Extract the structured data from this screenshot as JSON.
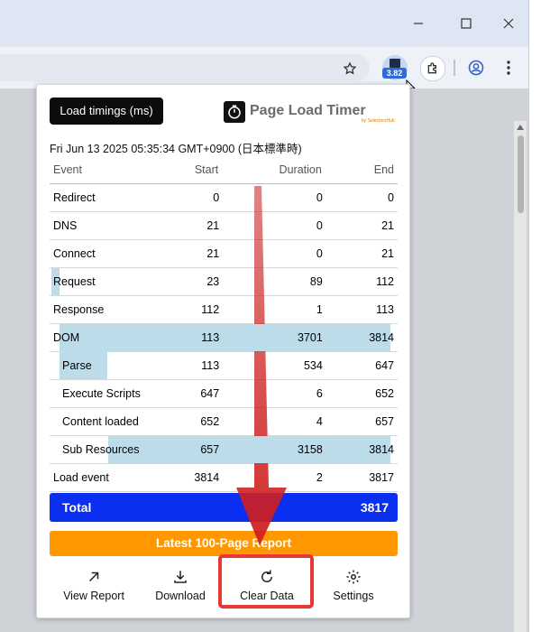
{
  "browser": {
    "extension_badge": "3.82",
    "colors": {
      "chrome_bg": "#dfe6f3",
      "page_dim": "#cfd3d8"
    },
    "icons": [
      "minimize-icon",
      "maximize-icon",
      "close-icon",
      "star-icon",
      "extension-icon",
      "puzzle-icon",
      "profile-icon",
      "menu-kebab-icon"
    ]
  },
  "popup": {
    "tab_label": "Load timings (ms)",
    "brand_title": "Page Load Timer",
    "brand_sub": "by SelectorsHub",
    "timestamp": "Fri Jun 13 2025 05:35:34 GMT+0900 (日本標準時)",
    "columns": {
      "event": "Event",
      "start": "Start",
      "duration": "Duration",
      "end": "End"
    },
    "rows": [
      {
        "event": "Redirect",
        "start": "0",
        "duration": "0",
        "end": "0",
        "indent": false,
        "bar_from": 0,
        "bar_to": 0
      },
      {
        "event": "DNS",
        "start": "21",
        "duration": "0",
        "end": "21",
        "indent": false,
        "bar_from": 0.0055,
        "bar_to": 0.0055
      },
      {
        "event": "Connect",
        "start": "21",
        "duration": "0",
        "end": "21",
        "indent": false,
        "bar_from": 0.0055,
        "bar_to": 0.0055
      },
      {
        "event": "Request",
        "start": "23",
        "duration": "89",
        "end": "112",
        "indent": false,
        "bar_from": 0.006,
        "bar_to": 0.0293
      },
      {
        "event": "Response",
        "start": "112",
        "duration": "1",
        "end": "113",
        "indent": false,
        "bar_from": 0.0293,
        "bar_to": 0.0296
      },
      {
        "event": "DOM",
        "start": "113",
        "duration": "3701",
        "end": "3814",
        "indent": false,
        "bar_from": 0.0296,
        "bar_to": 0.9992
      },
      {
        "event": "Parse",
        "start": "113",
        "duration": "534",
        "end": "647",
        "indent": true,
        "bar_from": 0.0296,
        "bar_to": 0.1695
      },
      {
        "event": "Execute Scripts",
        "start": "647",
        "duration": "6",
        "end": "652",
        "indent": true,
        "bar_from": 0.1695,
        "bar_to": 0.1708
      },
      {
        "event": "Content loaded",
        "start": "652",
        "duration": "4",
        "end": "657",
        "indent": true,
        "bar_from": 0.1708,
        "bar_to": 0.1721
      },
      {
        "event": "Sub Resources",
        "start": "657",
        "duration": "3158",
        "end": "3814",
        "indent": true,
        "bar_from": 0.1721,
        "bar_to": 0.9992
      },
      {
        "event": "Load event",
        "start": "3814",
        "duration": "2",
        "end": "3817",
        "indent": false,
        "bar_from": 0.9992,
        "bar_to": 1.0
      }
    ],
    "total_label": "Total",
    "total_value": "3817",
    "report_label": "Latest 100-Page Report",
    "actions": {
      "view_report": "View Report",
      "download": "Download",
      "clear_data": "Clear Data",
      "settings": "Settings"
    },
    "colors": {
      "total": "#0a2ff0",
      "report": "#ff9800",
      "bar": "#bcdcea",
      "highlight": "#e53935",
      "arrow": "#d32020"
    }
  }
}
